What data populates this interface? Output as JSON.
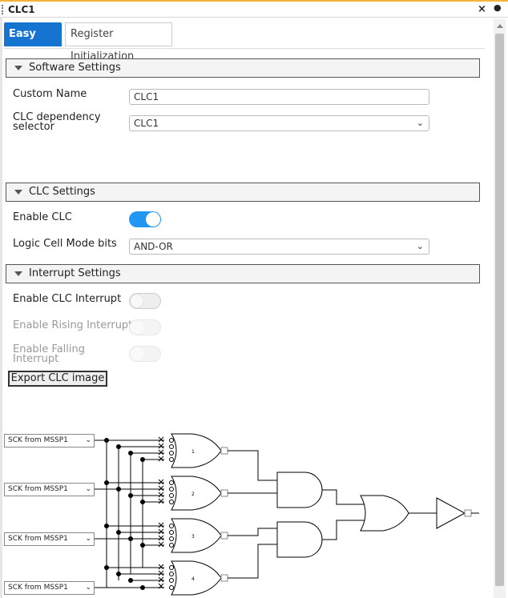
{
  "window": {
    "title": "CLC1",
    "close_glyph": "×",
    "pin_glyph": "●"
  },
  "tabs": [
    {
      "label": "Easy View",
      "active": true
    },
    {
      "label": "Register Initialization",
      "active": false
    }
  ],
  "software_settings": {
    "header": "Software Settings",
    "custom_name": {
      "label": "Custom Name",
      "value": "CLC1"
    },
    "dependency": {
      "label_line1": "CLC dependency",
      "label_line2": "selector",
      "value": "CLC1"
    }
  },
  "clc_settings": {
    "header": "CLC Settings",
    "enable_clc": {
      "label": "Enable CLC",
      "on": true
    },
    "logic_mode": {
      "label": "Logic Cell Mode bits",
      "value": "AND-OR"
    }
  },
  "interrupt_settings": {
    "header": "Interrupt Settings",
    "enable_interrupt": {
      "label": "Enable CLC Interrupt",
      "on": false
    },
    "rising": {
      "label": "Enable Rising Interrupt",
      "on": false,
      "disabled": true
    },
    "falling": {
      "label_line1": "Enable Falling",
      "label_line2": "Interrupt",
      "on": false,
      "disabled": true
    }
  },
  "export_button": "Export CLC image",
  "diagram": {
    "inputs": [
      "SCK from MSSP1",
      "SCK from MSSP1",
      "SCK from MSSP1",
      "SCK from MSSP1"
    ],
    "gate_numbers": [
      "1",
      "2",
      "3",
      "4"
    ]
  },
  "icons": {
    "collapse": "triangle-down-icon",
    "dropdown": "chevron-down-icon"
  }
}
